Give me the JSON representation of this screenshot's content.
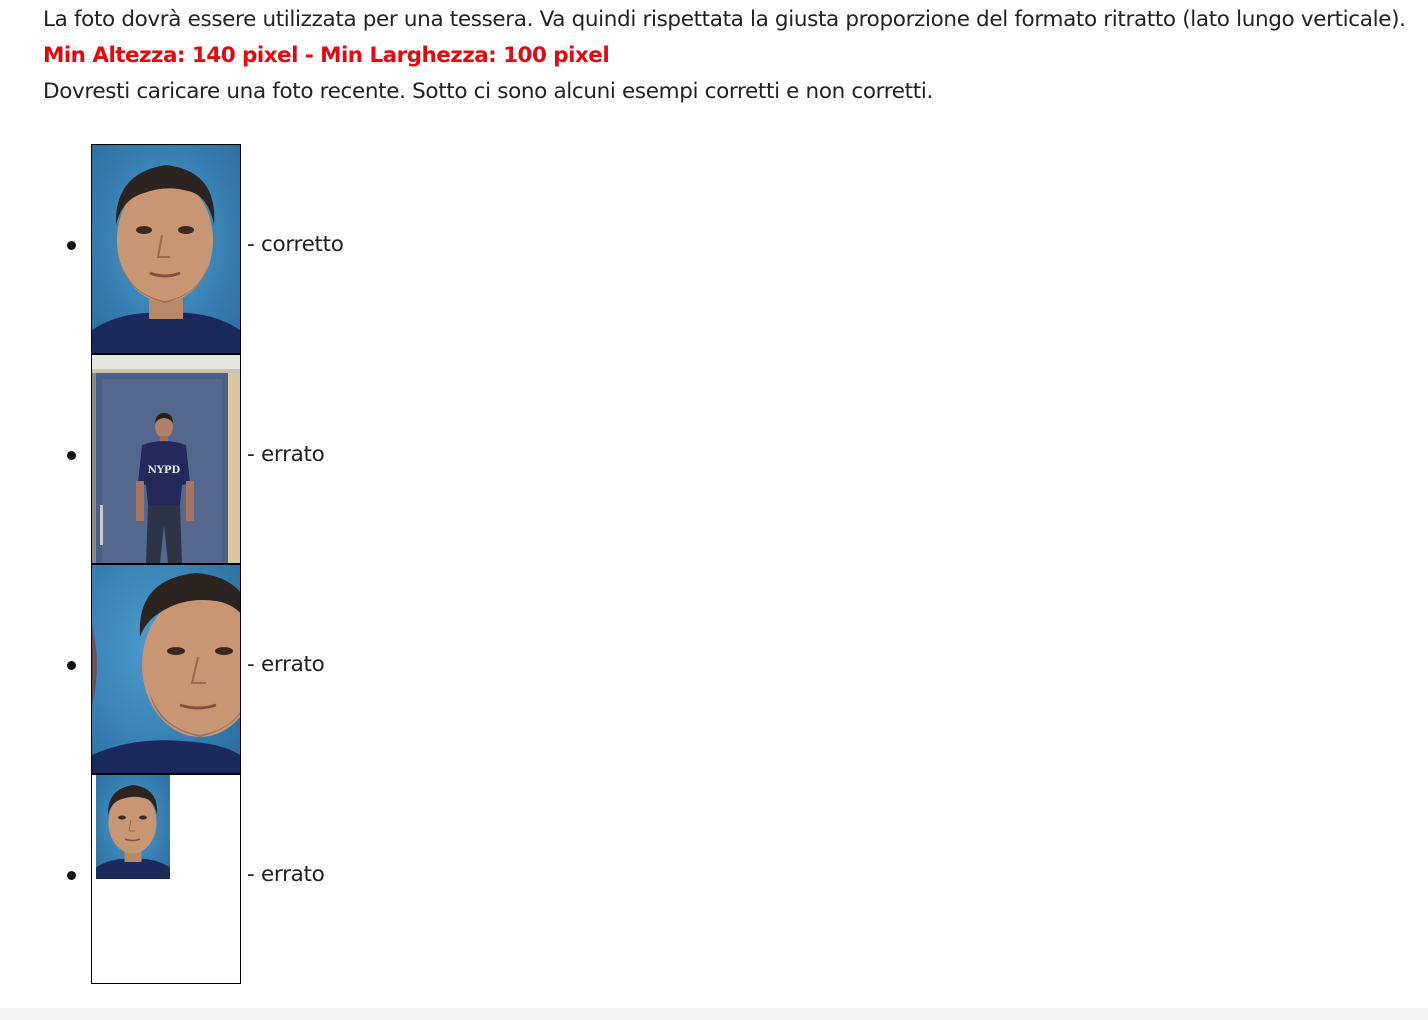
{
  "intro": {
    "line1": "La foto dovrà essere utilizzata per una tessera. Va quindi rispettata la giusta proporzione del formato ritratto (lato lungo verticale).",
    "requirement": "Min Altezza: 140 pixel - Min Larghezza: 100 pixel",
    "line3": "Dovresti caricare una foto recente. Sotto ci sono alcuni esempi corretti e non corretti."
  },
  "examples": [
    {
      "caption": "- corretto"
    },
    {
      "caption": "- errato"
    },
    {
      "caption": "- errato"
    },
    {
      "caption": "- errato"
    }
  ],
  "colors": {
    "requirement": "#e4080f",
    "text": "#222222",
    "photo_background": "#3b86b8",
    "shirt": "#1a2a5c"
  },
  "photo_texts": {
    "shirt_print": "NYPD"
  }
}
